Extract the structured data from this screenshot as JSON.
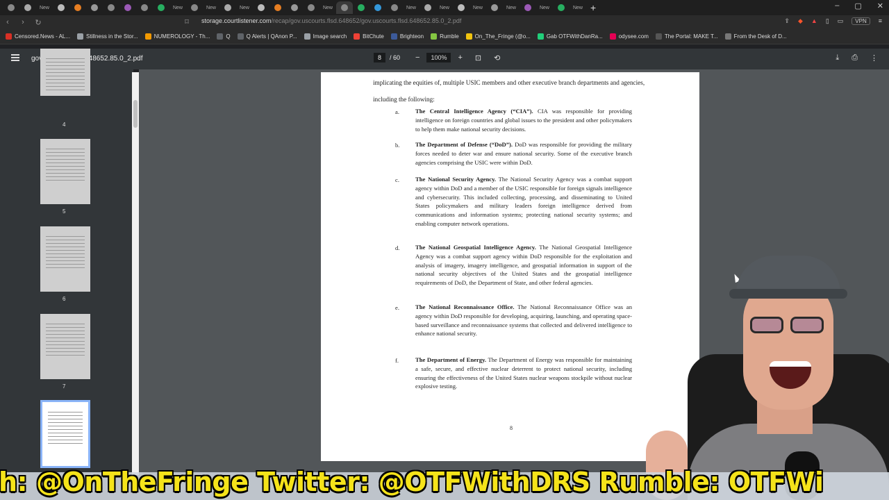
{
  "browser": {
    "tabs": [
      "",
      "",
      "New",
      "",
      "",
      "",
      "",
      "",
      "",
      "",
      "New",
      "",
      "New",
      "",
      "New",
      "",
      "",
      "",
      "",
      "New",
      "",
      "",
      "",
      "",
      "New",
      "",
      "New",
      "",
      "New",
      "",
      "New",
      "",
      "New",
      "",
      "New"
    ],
    "url_host": "storage.courtlistener.com",
    "url_path": "/recap/gov.uscourts.flsd.648652/gov.uscourts.flsd.648652.85.0_2.pdf",
    "vpn_label": "VPN",
    "bookmarks": [
      {
        "label": "Censored.News - AL...",
        "color": "#d93025"
      },
      {
        "label": "Stillness in the Stor...",
        "color": "#9aa0a6"
      },
      {
        "label": "NUMEROLOGY - Th...",
        "color": "#f29900"
      },
      {
        "label": "Q",
        "color": "#5f6368"
      },
      {
        "label": "Q Alerts | QAnon P...",
        "color": "#5f6368"
      },
      {
        "label": "Image search",
        "color": "#9aa0a6"
      },
      {
        "label": "BitChute",
        "color": "#ef4136"
      },
      {
        "label": "Brighteon",
        "color": "#3c5a99"
      },
      {
        "label": "Rumble",
        "color": "#85c742"
      },
      {
        "label": "On_The_Fringe (@o...",
        "color": "#f1c40f"
      },
      {
        "label": "Gab OTFWithDanRa...",
        "color": "#21cf7a"
      },
      {
        "label": "odysee.com",
        "color": "#e50054"
      },
      {
        "label": "The Portal: MAKE T...",
        "color": "#555"
      },
      {
        "label": "From the Desk of D...",
        "color": "#777"
      }
    ]
  },
  "pdf": {
    "file_name": "gov.uscourts.flsd.648652.85.0_2.pdf",
    "current_page": "8",
    "page_total": "/ 60",
    "zoom": "100%",
    "thumbnails": [
      "4",
      "5",
      "6",
      "7",
      ""
    ],
    "intro": "implicating the equities of, multiple USIC members and other executive branch departments and agencies, including the following:",
    "items": [
      {
        "letter": "a.",
        "title": "The Central Intelligence Agency (“CIA”).",
        "text": "CIA was responsible for providing intelligence on foreign countries and global issues to the president and other policymakers to help them make national security decisions."
      },
      {
        "letter": "b.",
        "title": "The Department of Defense (“DoD”).",
        "text": "DoD was responsible for providing the military forces needed to deter war and ensure national security. Some of the executive branch agencies comprising the USIC were within DoD."
      },
      {
        "letter": "c.",
        "title": "The National Security Agency.",
        "text": "The National Security Agency was a combat support agency within DoD and a member of the USIC responsible for foreign signals intelligence and cybersecurity. This included collecting, processing, and disseminating to United States policymakers and military leaders foreign intelligence derived from communications and information systems; protecting national security systems; and enabling computer network operations."
      },
      {
        "letter": "d.",
        "title": "The National Geospatial Intelligence Agency.",
        "text": "The National Geospatial Intelligence Agency was a combat support agency within DoD responsible for the exploitation and analysis of imagery, imagery intelligence, and geospatial information in support of the national security objectives of the United States and the geospatial intelligence requirements of DoD, the Department of State, and other federal agencies."
      },
      {
        "letter": "e.",
        "title": "The National Reconnaissance Office.",
        "text": "The National Reconnaissance Office was an agency within DoD responsible for developing, acquiring, launching, and operating space-based surveillance and reconnaissance systems that collected and delivered intelligence to enhance national security."
      },
      {
        "letter": "f.",
        "title": "The Department of Energy.",
        "text": "The Department of Energy was responsible for maintaining a safe, secure, and effective nuclear deterrent to protect national security, including ensuring the effectiveness of the United States nuclear weapons stockpile without nuclear explosive testing."
      }
    ],
    "page_number": "8"
  },
  "overlay": {
    "banner_text": "h: @OnTheFringe Twitter: @OTFWithDRS Rumble: OTFWi"
  }
}
